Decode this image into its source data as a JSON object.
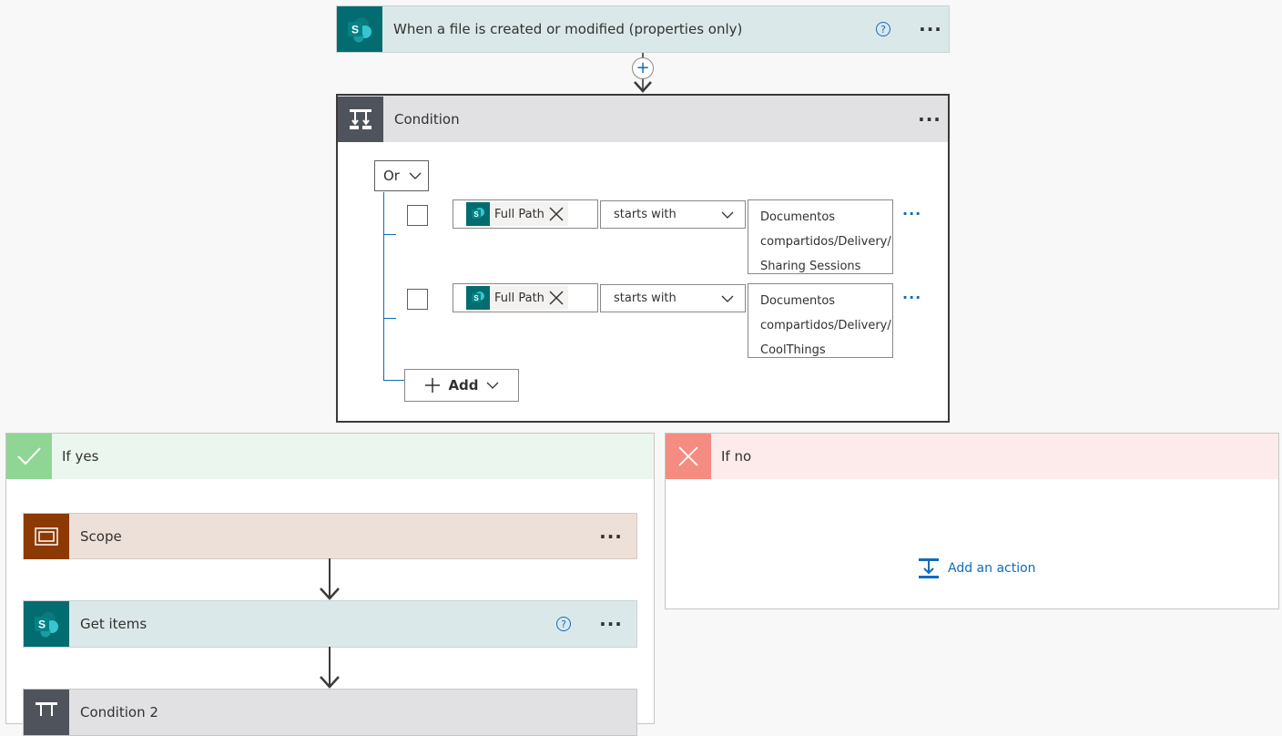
{
  "trigger": {
    "title": "When a file is created or modified (properties only)",
    "help": "?",
    "more": "···",
    "icon": "sharepoint-icon"
  },
  "connector": {
    "plus": "+"
  },
  "condition": {
    "title": "Condition",
    "more": "···",
    "operator": "Or",
    "rows": [
      {
        "token": "Full Path",
        "op": "starts with",
        "value_lines": [
          "Documentos",
          "compartidos/Delivery/",
          "Sharing Sessions"
        ],
        "more": "···"
      },
      {
        "token": "Full Path",
        "op": "starts with",
        "value_lines": [
          "Documentos",
          "compartidos/Delivery/",
          "CoolThings"
        ],
        "more": "···"
      }
    ],
    "add_label": "Add"
  },
  "if_yes": {
    "title": "If yes",
    "actions": [
      {
        "title": "Scope",
        "more": "···"
      },
      {
        "title": "Get items",
        "more": "···",
        "help": "?"
      },
      {
        "title": "Condition 2"
      }
    ]
  },
  "if_no": {
    "title": "If no",
    "add_action": "Add an action"
  },
  "colors": {
    "sharepoint": "#036c70",
    "condition_icon": "#4f535b",
    "scope_icon": "#8c3a02",
    "yes_icon": "#8fd694",
    "no_icon": "#f48c82",
    "accent": "#0f6cbd"
  }
}
